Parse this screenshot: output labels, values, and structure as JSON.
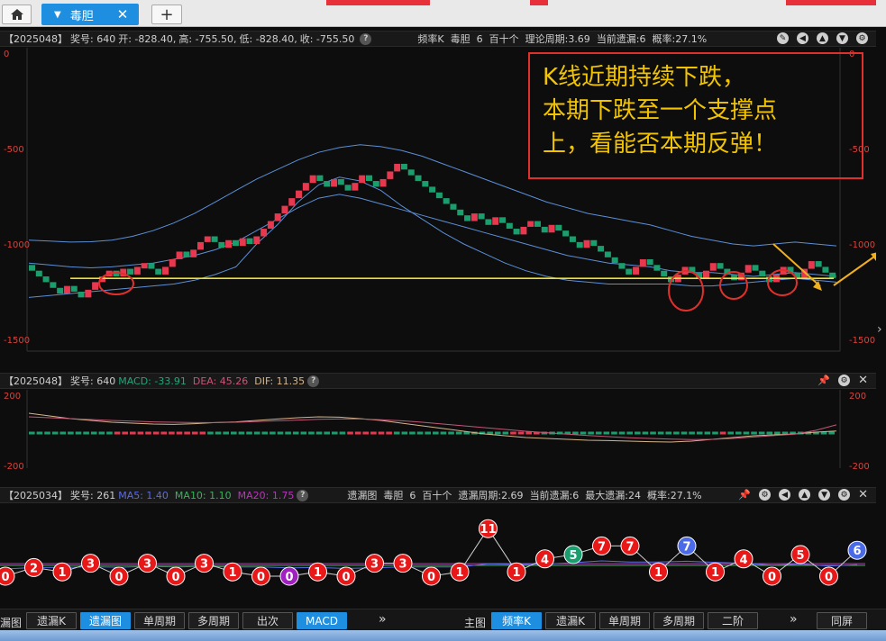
{
  "tabs": {
    "home_icon": "home-icon",
    "active_label": "毒胆",
    "close": "✕",
    "add": "+"
  },
  "main_panel": {
    "issue": "【2025048】",
    "award": "奖号: 640",
    "open": "开: -828.40,",
    "high": "高: -755.50,",
    "low": "低: -828.40,",
    "close": "收: -755.50",
    "help_icon": "?",
    "info": [
      "频率K",
      "毒胆",
      "6",
      "百十个",
      "理论周期:3.69",
      "当前遗漏:6",
      "概率:27.1%"
    ],
    "y_left": [
      "0",
      "-500",
      "-1000",
      "-1500"
    ],
    "y_right": [
      "0",
      "-500",
      "-1000",
      "-1500"
    ],
    "annotation": "K线近期持续下跌，\n本期下跌至一个支撑点\n上，看能否本期反弹！"
  },
  "macd_panel": {
    "issue": "【2025048】",
    "award": "奖号: 640",
    "macd": "MACD: -33.91",
    "dea": "DEA: 45.26",
    "dif": "DIF: 11.35",
    "help_icon": "?",
    "y_left": [
      "200",
      "-200"
    ],
    "y_right": [
      "200",
      "-200"
    ]
  },
  "miss_panel": {
    "issue": "【2025034】",
    "award": "奖号: 261",
    "ma5": "MA5: 1.40",
    "ma10": "MA10: 1.10",
    "ma20": "MA20: 1.75",
    "help_icon": "?",
    "info": [
      "遗漏图",
      "毒胆",
      "6",
      "百十个",
      "遗漏周期:2.69",
      "当前遗漏:6",
      "最大遗漏:24",
      "概率:27.1%"
    ],
    "points": [
      0,
      2,
      1,
      3,
      0,
      3,
      0,
      3,
      1,
      0,
      0,
      1,
      0,
      3,
      3,
      0,
      1,
      11,
      1,
      4,
      5,
      7,
      7,
      1,
      7,
      1,
      4,
      0,
      5,
      0,
      6
    ]
  },
  "bottom_bar": {
    "left_items": [
      "漏图",
      "遗漏K",
      "遗漏图",
      "单周期",
      "多周期",
      "出次",
      "MACD"
    ],
    "left_more": "»",
    "main_label": "主图",
    "right_items": [
      "频率K",
      "遗漏K",
      "单周期",
      "多周期",
      "二阶"
    ],
    "right_more": "»",
    "same_screen": "同屏"
  },
  "colors": {
    "up": "#e8384f",
    "down": "#1a9e6e",
    "band": "#5b8fd6",
    "support": "#f0e030",
    "ma5": "#5a6ce6",
    "ma10": "#3bb25c",
    "ma20": "#c030c0"
  },
  "chart_data": [
    {
      "type": "candlestick",
      "ylim": [
        -1500,
        0
      ],
      "y_ticks": [
        0,
        -500,
        -1000,
        -1500
      ],
      "support_level": -1180,
      "candles": [
        -1140,
        -1170,
        -1200,
        -1230,
        -1260,
        -1220,
        -1250,
        -1280,
        -1240,
        -1200,
        -1170,
        -1140,
        -1170,
        -1130,
        -1160,
        -1120,
        -1100,
        -1130,
        -1160,
        -1120,
        -1080,
        -1040,
        -1070,
        -1030,
        -990,
        -960,
        -990,
        -1020,
        -980,
        -1010,
        -970,
        -1000,
        -960,
        -920,
        -880,
        -840,
        -800,
        -760,
        -720,
        -680,
        -640,
        -670,
        -700,
        -660,
        -690,
        -720,
        -680,
        -640,
        -670,
        -700,
        -660,
        -620,
        -580,
        -610,
        -640,
        -670,
        -700,
        -730,
        -760,
        -790,
        -820,
        -850,
        -880,
        -840,
        -870,
        -900,
        -860,
        -890,
        -920,
        -950,
        -910,
        -880,
        -910,
        -940,
        -900,
        -930,
        -960,
        -990,
        -1020,
        -980,
        -1010,
        -1040,
        -1070,
        -1100,
        -1130,
        -1160,
        -1120,
        -1080,
        -1110,
        -1140,
        -1170,
        -1200,
        -1160,
        -1120,
        -1150,
        -1180,
        -1140,
        -1100,
        -1130,
        -1160,
        -1190,
        -1150,
        -1110,
        -1140,
        -1170,
        -1200,
        -1160,
        -1120,
        -1150,
        -1180,
        -1130,
        -1090,
        -1120,
        -1150,
        -1180
      ],
      "band_upper": [
        -980,
        -985,
        -990,
        -988,
        -980,
        -960,
        -930,
        -890,
        -840,
        -780,
        -720,
        -660,
        -610,
        -560,
        -520,
        -495,
        -480,
        -490,
        -510,
        -540,
        -580,
        -620,
        -660,
        -700,
        -740,
        -780,
        -810,
        -840,
        -860,
        -880,
        -900,
        -930,
        -960,
        -980,
        -1000,
        -1010,
        -1000,
        -990,
        -1000,
        -1010
      ],
      "band_middle": [
        -1100,
        -1110,
        -1120,
        -1125,
        -1120,
        -1110,
        -1100,
        -1080,
        -1060,
        -1030,
        -990,
        -930,
        -870,
        -810,
        -760,
        -740,
        -760,
        -790,
        -820,
        -850,
        -880,
        -910,
        -940,
        -970,
        -1000,
        -1030,
        -1060,
        -1080,
        -1100,
        -1110,
        -1120,
        -1140,
        -1150,
        -1150,
        -1160,
        -1170,
        -1160,
        -1150,
        -1160,
        -1170
      ],
      "band_lower": [
        -1280,
        -1270,
        -1260,
        -1250,
        -1240,
        -1230,
        -1220,
        -1210,
        -1190,
        -1160,
        -1120,
        -1000,
        -900,
        -780,
        -690,
        -650,
        -670,
        -720,
        -800,
        -870,
        -940,
        -1000,
        -1050,
        -1100,
        -1140,
        -1170,
        -1190,
        -1200,
        -1210,
        -1210,
        -1210,
        -1210,
        -1220,
        -1220,
        -1210,
        -1200,
        -1190,
        -1180,
        -1190,
        -1200
      ]
    },
    {
      "type": "bar",
      "ylim": [
        -200,
        200
      ],
      "macd": [
        -20,
        -22,
        -24,
        -26,
        -25,
        -22,
        -20,
        -15,
        -10,
        -6,
        -3,
        0,
        4,
        8,
        12,
        15,
        18,
        20,
        18,
        15,
        10,
        5,
        0,
        -4,
        -8,
        -12,
        -16,
        -18,
        -20,
        -22,
        -24,
        -26,
        -28,
        -30,
        -28,
        -25,
        -20,
        -15,
        -10,
        -5,
        -2,
        2,
        4,
        6,
        5,
        3,
        0,
        -4,
        -8,
        -12,
        -15,
        -18,
        -20,
        -22,
        -24,
        -20,
        -16,
        -12,
        -8,
        -5,
        -3,
        -1,
        0,
        1,
        2,
        0,
        -2,
        -4,
        -6,
        -8,
        -10,
        -12,
        -14,
        -16,
        -18,
        -20,
        -22,
        -24,
        -22,
        -20,
        -18,
        -16,
        -14,
        -12,
        -10,
        -8,
        -6,
        -4,
        -2,
        0,
        -3,
        -6,
        -9,
        -12,
        -15,
        -18,
        -20,
        -22,
        -24,
        -26,
        -28,
        -30,
        -32,
        -33.91
      ],
      "dif": [
        110,
        95,
        80,
        70,
        60,
        55,
        50,
        48,
        52,
        58,
        62,
        70,
        78,
        85,
        90,
        88,
        80,
        70,
        55,
        40,
        25,
        10,
        -5,
        -15,
        -25,
        -30,
        -35,
        -40,
        -42,
        -45,
        -48,
        -50,
        -45,
        -35,
        -25,
        -15,
        -10,
        -5,
        5,
        11.35
      ],
      "dea": [
        90,
        85,
        80,
        75,
        70,
        66,
        62,
        60,
        58,
        58,
        60,
        64,
        68,
        72,
        76,
        78,
        78,
        74,
        68,
        60,
        50,
        40,
        30,
        20,
        10,
        2,
        -6,
        -14,
        -20,
        -26,
        -30,
        -34,
        -36,
        -35,
        -30,
        -22,
        -14,
        -6,
        15,
        45.26
      ]
    },
    {
      "type": "line",
      "values": [
        0,
        2,
        1,
        3,
        0,
        3,
        0,
        3,
        1,
        0,
        0,
        1,
        0,
        3,
        3,
        0,
        1,
        11,
        1,
        4,
        5,
        7,
        7,
        1,
        7,
        1,
        4,
        0,
        5,
        0,
        6
      ],
      "ylim": [
        0,
        12
      ]
    }
  ]
}
